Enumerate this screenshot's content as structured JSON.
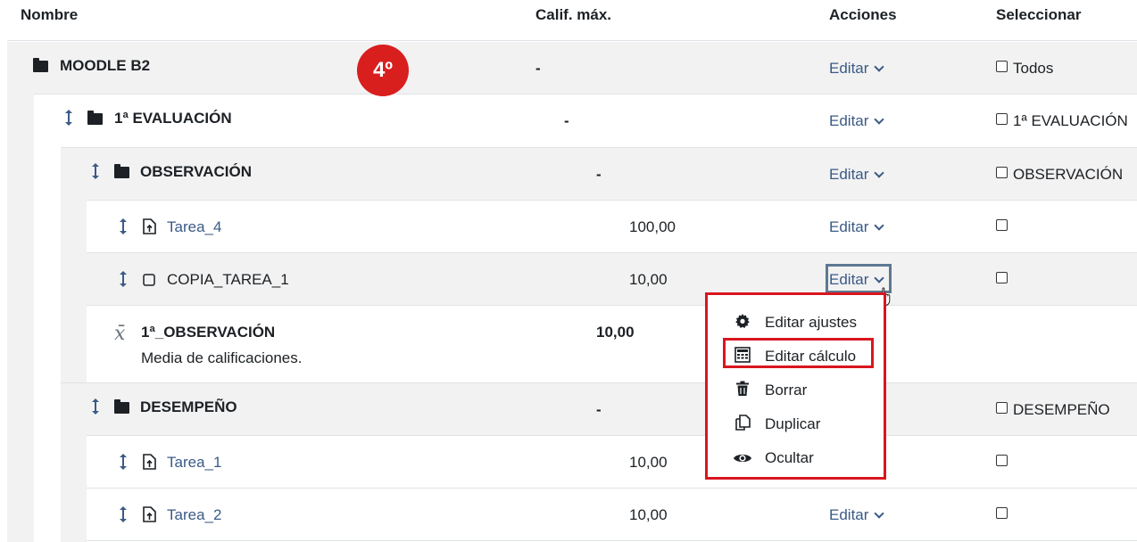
{
  "header": {
    "nombre": "Nombre",
    "calif": "Calif. máx.",
    "acciones": "Acciones",
    "seleccionar": "Seleccionar"
  },
  "badge": "4º",
  "rows": {
    "moodle": {
      "name": "MOODLE B2",
      "calif": "-",
      "action": "Editar",
      "select": "Todos"
    },
    "eval1": {
      "name": "1ª EVALUACIÓN",
      "calif": "-",
      "action": "Editar",
      "select": "1ª EVALUACIÓN"
    },
    "observ": {
      "name": "OBSERVACIÓN",
      "calif": "-",
      "action": "Editar",
      "select": "OBSERVACIÓN"
    },
    "tarea4": {
      "name": "Tarea_4",
      "calif": "100,00",
      "action": "Editar"
    },
    "copia": {
      "name": "COPIA_TAREA_1",
      "calif": "10,00",
      "action": "Editar"
    },
    "obs1": {
      "name": "1ª_OBSERVACIÓN",
      "sub": "Media de calificaciones.",
      "calif": "10,00"
    },
    "desemp": {
      "name": "DESEMPEÑO",
      "calif": "-",
      "select": "DESEMPEÑO"
    },
    "tarea1": {
      "name": "Tarea_1",
      "calif": "10,00"
    },
    "tarea2": {
      "name": "Tarea_2",
      "calif": "10,00",
      "action": "Editar"
    }
  },
  "menu": {
    "items": [
      {
        "label": "Editar ajustes",
        "icon": "gear-icon"
      },
      {
        "label": "Editar cálculo",
        "icon": "calculator-icon"
      },
      {
        "label": "Borrar",
        "icon": "trash-icon"
      },
      {
        "label": "Duplicar",
        "icon": "copy-icon"
      },
      {
        "label": "Ocultar",
        "icon": "eye-icon"
      }
    ]
  },
  "colors": {
    "link": "#3b5a86",
    "highlight": "#d9161f",
    "band": "#f2f2f2"
  }
}
